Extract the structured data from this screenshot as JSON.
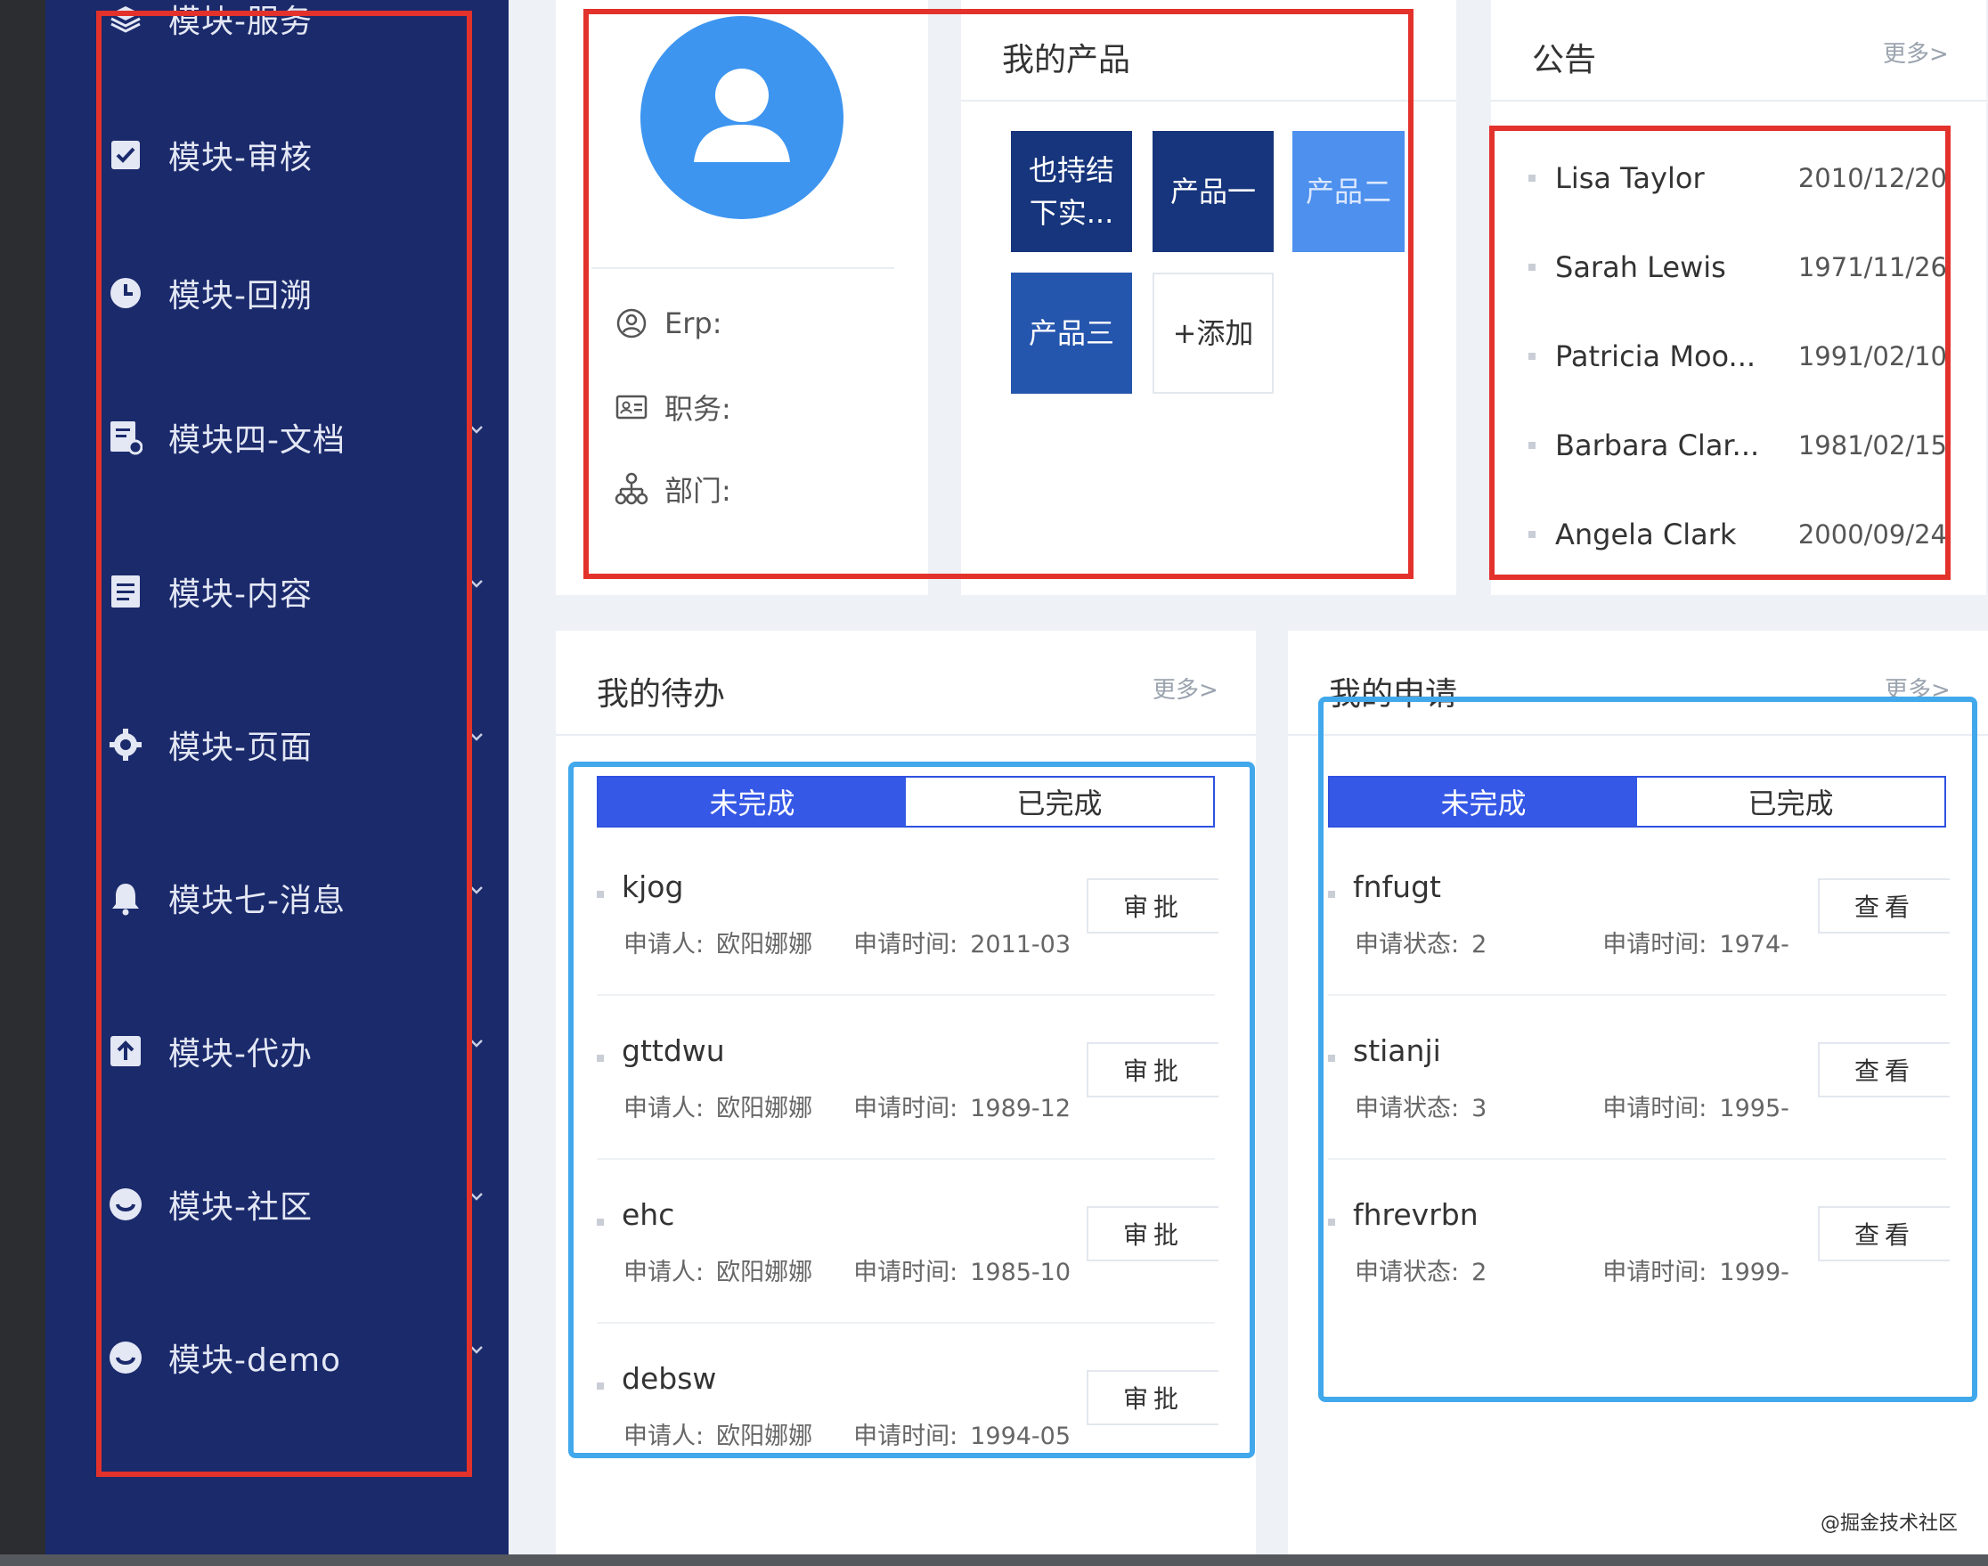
{
  "sidebar": {
    "items": [
      {
        "label": "模块-服务",
        "icon": "layers-icon",
        "has_arrow": false
      },
      {
        "label": "模块-审核",
        "icon": "checkbox-icon",
        "has_arrow": false
      },
      {
        "label": "模块-回溯",
        "icon": "clock-icon",
        "has_arrow": false
      },
      {
        "label": "模块四-文档",
        "icon": "document-settings-icon",
        "has_arrow": true
      },
      {
        "label": "模块-内容",
        "icon": "list-document-icon",
        "has_arrow": true
      },
      {
        "label": "模块-页面",
        "icon": "gear-icon",
        "has_arrow": true
      },
      {
        "label": "模块七-消息",
        "icon": "bell-icon",
        "has_arrow": true
      },
      {
        "label": "模块-代办",
        "icon": "upload-icon",
        "has_arrow": true
      },
      {
        "label": "模块-社区",
        "icon": "smile-icon",
        "has_arrow": true
      },
      {
        "label": "模块-demo",
        "icon": "smile-icon",
        "has_arrow": true
      }
    ]
  },
  "profile": {
    "erp_label": "Erp:",
    "position_label": "职务:",
    "department_label": "部门:"
  },
  "products": {
    "title": "我的产品",
    "tiles": [
      "也持结下实...",
      "产品一",
      "产品二",
      "产品三",
      "+添加"
    ]
  },
  "announcements": {
    "title": "公告",
    "more": "更多>",
    "items": [
      {
        "name": "Lisa Taylor",
        "date": "2010/12/20"
      },
      {
        "name": "Sarah Lewis",
        "date": "1971/11/26"
      },
      {
        "name": "Patricia Moo...",
        "date": "1991/02/10"
      },
      {
        "name": "Barbara Clar...",
        "date": "1981/02/15"
      },
      {
        "name": "Angela Clark",
        "date": "2000/09/24"
      }
    ]
  },
  "todo": {
    "title": "我的待办",
    "more": "更多>",
    "tab_incomplete": "未完成",
    "tab_complete": "已完成",
    "applicant_label": "申请人:",
    "time_label": "申请时间:",
    "button_label": "审批",
    "items": [
      {
        "title": "kjog",
        "applicant": "欧阳娜娜",
        "time": "2011-03"
      },
      {
        "title": "gttdwu",
        "applicant": "欧阳娜娜",
        "time": "1989-12"
      },
      {
        "title": "ehc",
        "applicant": "欧阳娜娜",
        "time": "1985-10"
      },
      {
        "title": "debsw",
        "applicant": "欧阳娜娜",
        "time": "1994-05"
      }
    ]
  },
  "applications": {
    "title": "我的申请",
    "more": "更多>",
    "tab_incomplete": "未完成",
    "tab_complete": "已完成",
    "status_label": "申请状态:",
    "time_label": "申请时间:",
    "button_label": "查看",
    "items": [
      {
        "title": "fnfugt",
        "status": "2",
        "time": "1974-"
      },
      {
        "title": "stianji",
        "status": "3",
        "time": "1995-"
      },
      {
        "title": "fhrevrbn",
        "status": "2",
        "time": "1999-"
      }
    ]
  },
  "footer": {
    "credit": "@掘金技术社区"
  },
  "colors": {
    "sidebar_bg": "#1b2a6b",
    "accent_blue": "#3558e6",
    "avatar_blue": "#3d95f0",
    "highlight_red": "#e3322b",
    "highlight_blue": "#41a8ec"
  }
}
